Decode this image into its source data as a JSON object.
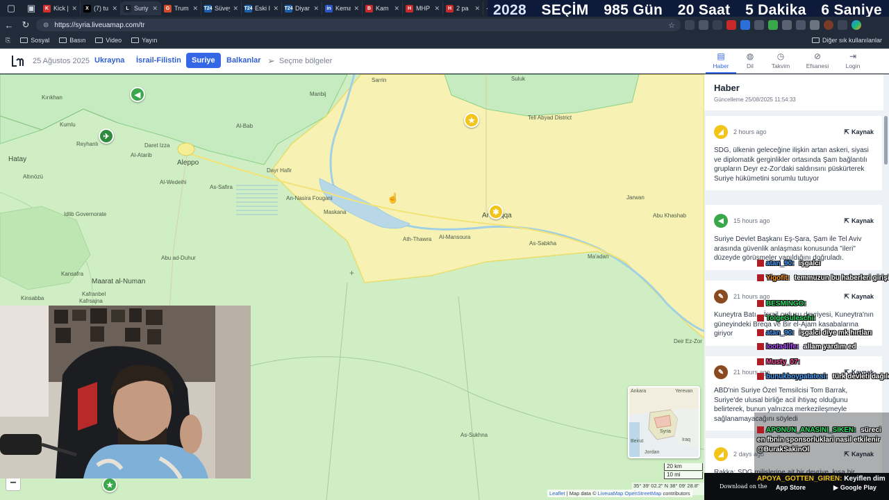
{
  "browser": {
    "tabs": [
      {
        "label": "Kick |",
        "color": "#d42e2e",
        "fav": "K"
      },
      {
        "label": "(7) tu",
        "color": "#000000",
        "fav": "X"
      },
      {
        "label": "Suriy",
        "color": "#1b2433",
        "fav": "L",
        "active": true
      },
      {
        "label": "Trum",
        "color": "#d64a28",
        "fav": "G"
      },
      {
        "label": "Süvey",
        "color": "#1d5fa8",
        "fav": "T24"
      },
      {
        "label": "Eski I",
        "color": "#1d5fa8",
        "fav": "T24"
      },
      {
        "label": "Diyar",
        "color": "#1d5fa8",
        "fav": "T24"
      },
      {
        "label": "Kema",
        "color": "#2a56c6",
        "fav": "in"
      },
      {
        "label": "Kam",
        "color": "#c62a2a",
        "fav": "B"
      },
      {
        "label": "MHP",
        "color": "#c62a2a",
        "fav": "H"
      },
      {
        "label": "2 pa",
        "color": "#c62a2a",
        "fav": "H"
      }
    ],
    "url": "https://syria.liveuamap.com/tr",
    "bookmarks": [
      "Sosyal",
      "Basın",
      "Video",
      "Yayın"
    ],
    "bookmarks_right": "Diğer sık kullanılanlar"
  },
  "countdown": {
    "year": "2028",
    "title": "SEÇİM",
    "days": "985 Gün",
    "hours": "20 Saat",
    "minutes": "5 Dakika",
    "seconds": "6 Saniye"
  },
  "header": {
    "logo": "Lm",
    "date": "25 Ağustos 2025",
    "nav": [
      "Ukrayna",
      "İsrail-Filistin",
      "Suriye",
      "Balkanlar"
    ],
    "active_nav": "Suriye",
    "region_button": "Seçme bölgeler",
    "tools": [
      {
        "label": "Haber",
        "icon": "document-icon",
        "active": true
      },
      {
        "label": "Dil",
        "icon": "globe-icon"
      },
      {
        "label": "Takvim",
        "icon": "clock-icon"
      },
      {
        "label": "Efsanesi",
        "icon": "compass-icon"
      },
      {
        "label": "Login",
        "icon": "login-icon"
      }
    ]
  },
  "map": {
    "labels": {
      "kirikhan": "Kırıkhan",
      "kumlu": "Kumlu",
      "reyhanli": "Reyhanlı",
      "hatay": "Hatay",
      "altinozu": "Altınözü",
      "aleppo": "Aleppo",
      "as_safira": "As-Safira",
      "al_bab": "Al-Bab",
      "manbij": "Manbij",
      "sarrin": "Sarrin",
      "suluk": "Suluk",
      "tel_abyad": "Tell Abyad District",
      "ar_raqqa": "Ar-Raqqa",
      "ath_thawra": "Ath-Thawra",
      "al_mansoura": "Al-Mansoura",
      "as_sabkha": "As-Sabkha",
      "maskana": "Maskana",
      "an_nasira": "An-Nasira Fougani",
      "dayr_hafir": "Dayr Hafir",
      "jarwan": "Jarwan",
      "abu_khashab": "Abu Khashab",
      "idlib": "Idlib Governorate",
      "al_atarib": "Al-Atarib",
      "al_wedeihi": "Al-Wedeihi",
      "abu_ad_duhur": "Abu ad-Duhur",
      "maarat": "Maarat al-Numan",
      "kafranbel": "Kafranbel",
      "kafrsajna": "Kafrsajna",
      "kansafra": "Kansafra",
      "kinsabba": "Kinsabba",
      "as_sukhna": "As-Sukhna",
      "deir_ez_zor": "Deir Ez-Zor",
      "al_qaim": "Ma'adan",
      "daret_izza": "Daret Izza"
    },
    "minimap": {
      "ankara": "Ankara",
      "yerevan": "Yerevan",
      "beirut": "Beirut",
      "syria": "Syria",
      "iraq": "Iraq",
      "jordan": "Jordan"
    },
    "scale_km": "20 km",
    "scale_mi": "10 mi",
    "coords": "35° 39' 02.2\" N 38° 09' 28.8\" E",
    "attribution_leaflet": "Leaflet",
    "attribution_mid": " | Map data © ",
    "attribution_links": "LiveuaMap OpenStreetMap",
    "attribution_end": " contributors",
    "zoom_out": "−"
  },
  "news": {
    "title": "Haber",
    "updated": "Güncelleme 25/08/2025 11:54:33",
    "source_label": "Kaynak",
    "items": [
      {
        "time": "2 hours ago",
        "icon": "yellow",
        "text": "SDG, ülkenin geleceğine ilişkin artan askeri, siyasi ve diplomatik gerginlikler ortasında Şam bağlantılı grupların Deyr ez-Zor'daki saldırısını püskürterek Suriye hükümetini sorumlu tutuyor"
      },
      {
        "time": "15 hours ago",
        "icon": "green",
        "text": "Suriye Devlet Başkanı Eş-Şara, Şam ile Tel Aviv arasında güvenlik anlaşması konusunda \"ileri\" düzeyde görüşmeler yapıldığını doğruladı."
      },
      {
        "time": "21 hours ago",
        "icon": "brown",
        "text": "Kuneytra Batı... İsrail ordusu devriyesi, Kuneytra'nın güneyindeki Breqa ve Bir el-Ajam kasabalarına giriyor"
      },
      {
        "time": "21 hours ago",
        "icon": "brown",
        "text": "ABD'nin Suriye Özel Temsilcisi Tom Barrak, Suriye'de ulusal birliğe acil ihtiyaç olduğunu belirterek, bunun yalnızca merkezileşmeyle sağlanamayacağını söyledi"
      },
      {
        "time": "2 days ago",
        "icon": "yellow",
        "text": "Rakka: SDG milislerine ait bir devriye, kısa bir"
      }
    ]
  },
  "chat": [
    {
      "user": "atan_90:",
      "msg": " işgalci",
      "color": "#4aa3ff"
    },
    {
      "user": "Yigofit:",
      "msg": " temmuzun bu haberleri girişi beni yakıyor",
      "color": "#ff9a1f"
    },
    {
      "user": "BESMINGO:",
      "msg": "",
      "color": "#2fe06b"
    },
    {
      "user": "TolgeGuleschi:",
      "msg": "",
      "color": "#2fe06b"
    },
    {
      "user": "atan_90:",
      "msg": " işgalci diye mk hırtları",
      "color": "#4aa3ff"
    },
    {
      "user": "loota4life:",
      "msg": " allam yardım ed",
      "color": "#b24fff"
    },
    {
      "user": "Musty_07:",
      "msg": "",
      "color": "#ff4fa0"
    },
    {
      "user": "bunukboypatatesi:",
      "msg": " türk devleti dağıldı?",
      "color": "#4aa3ff"
    },
    {
      "user": "APONUN_ANASINI_SIKEN:",
      "msg": " süreci en fbnin sponsorluklari nasil etkilenir @BurakSakinOl",
      "color": "#2fe06b"
    }
  ],
  "banner": {
    "user": "APOYA_GOTTEN_GIREN:",
    "msg": " Keyiflen dim",
    "download": "Download on the",
    "appstore": "App Store",
    "googleplay": "Google Play"
  },
  "colors": {
    "accent": "#3466e6",
    "government_zone": "#cfeec4",
    "sdf_zone": "#f7f2b4",
    "turkey_zone": "#c6ebc0"
  }
}
